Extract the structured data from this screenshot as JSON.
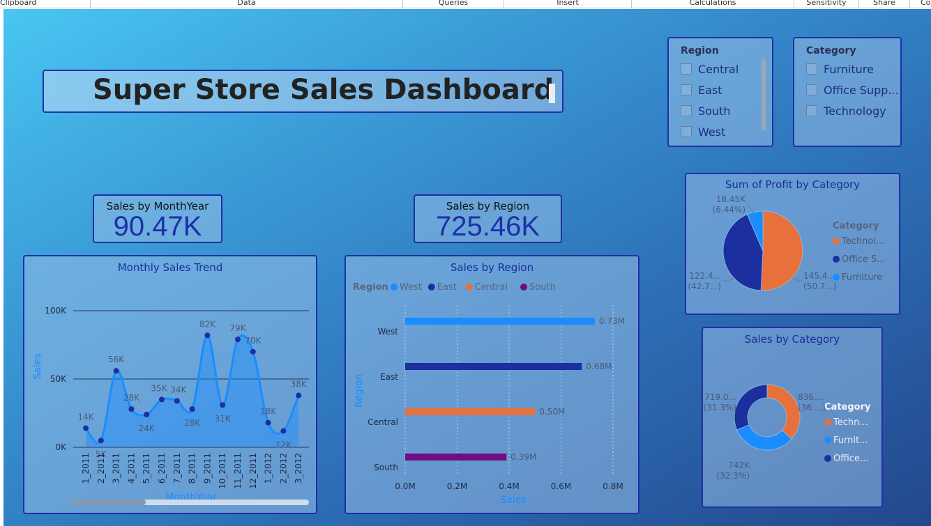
{
  "ribbon": {
    "sections": [
      "Clipboard",
      "Data",
      "Queries",
      "Insert",
      "Calculations",
      "Sensitivity",
      "Share",
      "Co"
    ]
  },
  "dashboard": {
    "title": "Super Store Sales Dashboard"
  },
  "kpis": {
    "month": {
      "label": "Sales by MonthYear",
      "value": "90.47K"
    },
    "region": {
      "label": "Sales by Region",
      "value": "725.46K"
    }
  },
  "slicers": {
    "region": {
      "title": "Region",
      "items": [
        "Central",
        "East",
        "South",
        "West"
      ]
    },
    "category": {
      "title": "Category",
      "items": [
        "Furniture",
        "Office Supp...",
        "Technology"
      ]
    }
  },
  "colors": {
    "blue": "#1a8cff",
    "navy": "#1b2f9e",
    "orange": "#e8703a",
    "purple": "#6e0e82",
    "title": "#1a2d9c"
  },
  "chart_data": [
    {
      "type": "area",
      "title": "Monthly Sales Trend",
      "xlabel": "MonthYear",
      "ylabel": "Sales",
      "categories": [
        "1_2011",
        "2_2011",
        "3_2011",
        "4_2011",
        "5_2011",
        "6_2011",
        "7_2011",
        "8_2011",
        "9_2011",
        "10_2011",
        "11_2011",
        "12_2011",
        "1_2012",
        "2_2012",
        "3_2012"
      ],
      "values": [
        14,
        5,
        56,
        28,
        24,
        35,
        34,
        28,
        82,
        31,
        79,
        70,
        18,
        12,
        38
      ],
      "labels": [
        "14K",
        "5K",
        "56K",
        "28K",
        "24K",
        "35K",
        "34K",
        "28K",
        "82K",
        "31K",
        "79K",
        "70K",
        "18K",
        "12K",
        "38K"
      ],
      "ylim": [
        0,
        100
      ],
      "yticks": [
        0,
        50,
        100
      ],
      "ytick_labels": [
        "0K",
        "50K",
        "100K"
      ],
      "grid": true
    },
    {
      "type": "bar",
      "title": "Sales by Region",
      "legend_title": "Region",
      "xlabel": "Sales",
      "ylabel": "Region",
      "categories": [
        "West",
        "East",
        "Central",
        "South"
      ],
      "values": [
        0.73,
        0.68,
        0.5,
        0.39
      ],
      "labels": [
        "0.73M",
        "0.68M",
        "0.50M",
        "0.39M"
      ],
      "colors": [
        "#1a8cff",
        "#1b2f9e",
        "#e8703a",
        "#6e0e82"
      ],
      "legend": [
        "West",
        "East",
        "Central",
        "South"
      ],
      "xlim": [
        0,
        0.8
      ],
      "xtick_labels": [
        "0.0M",
        "0.2M",
        "0.4M",
        "0.6M",
        "0.8M"
      ]
    },
    {
      "type": "pie",
      "title": "Sum of Profit by Category",
      "legend_title": "Category",
      "legend": [
        "Technol...",
        "Office S...",
        "Furniture"
      ],
      "categories": [
        "Technology",
        "Office Supplies",
        "Furniture"
      ],
      "values": [
        50.7,
        42.7,
        6.44
      ],
      "colors": [
        "#e8703a",
        "#1b2f9e",
        "#1a8cff"
      ],
      "labels": [
        {
          "value": "145.4...",
          "pct": "(50.7...)"
        },
        {
          "value": "122.4...",
          "pct": "(42.7...)"
        },
        {
          "value": "18.45K",
          "pct": "(6.44%)"
        }
      ]
    },
    {
      "type": "pie",
      "title": "Sales by Category",
      "legend_title": "Category",
      "legend": [
        "Techn...",
        "Furnit...",
        "Office..."
      ],
      "categories": [
        "Technology",
        "Furniture",
        "Office Supplies"
      ],
      "values": [
        36.4,
        32.3,
        31.3
      ],
      "colors": [
        "#e8703a",
        "#1a8cff",
        "#1b2f9e"
      ],
      "labels": [
        {
          "value": "836....",
          "pct": "(36....)"
        },
        {
          "value": "742K",
          "pct": "(32.3%)"
        },
        {
          "value": "719.0...",
          "pct": "(31.3%)"
        }
      ]
    }
  ]
}
